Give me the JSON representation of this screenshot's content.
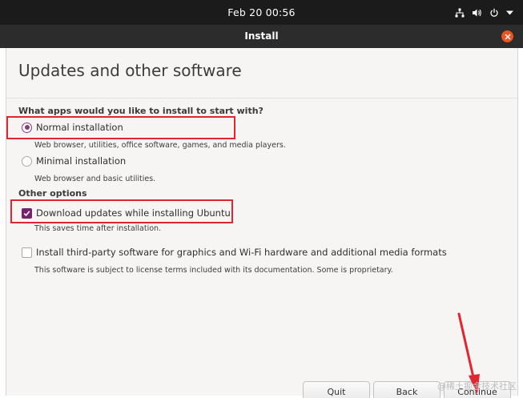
{
  "topbar": {
    "clock": "Feb 20  00:56"
  },
  "window": {
    "title": "Install"
  },
  "page": {
    "title": "Updates and other software"
  },
  "apps_section": {
    "heading": "What apps would you like to install to start with?",
    "normal": {
      "label": "Normal installation",
      "description": "Web browser, utilities, office software, games, and media players.",
      "selected": true
    },
    "minimal": {
      "label": "Minimal installation",
      "description": "Web browser and basic utilities.",
      "selected": false
    }
  },
  "other_section": {
    "heading": "Other options",
    "updates": {
      "label": "Download updates while installing Ubuntu",
      "description": "This saves time after installation.",
      "checked": true
    },
    "thirdparty": {
      "label": "Install third-party software for graphics and Wi-Fi hardware and additional media formats",
      "description": "This software is subject to license terms included with its documentation. Some is proprietary.",
      "checked": false
    }
  },
  "buttons": {
    "quit": "Quit",
    "back": "Back",
    "continue": "Continue"
  },
  "watermark": "@稀土掘金技术社区",
  "colors": {
    "accent": "#77216f",
    "radio": "#8c3a7c",
    "close": "#e95420",
    "highlight": "#e0272f"
  },
  "icons": {
    "network": "network-wired-icon",
    "volume": "volume-icon",
    "power": "power-icon",
    "menu": "chevron-down-icon",
    "close": "close-icon",
    "check": "check-icon"
  }
}
